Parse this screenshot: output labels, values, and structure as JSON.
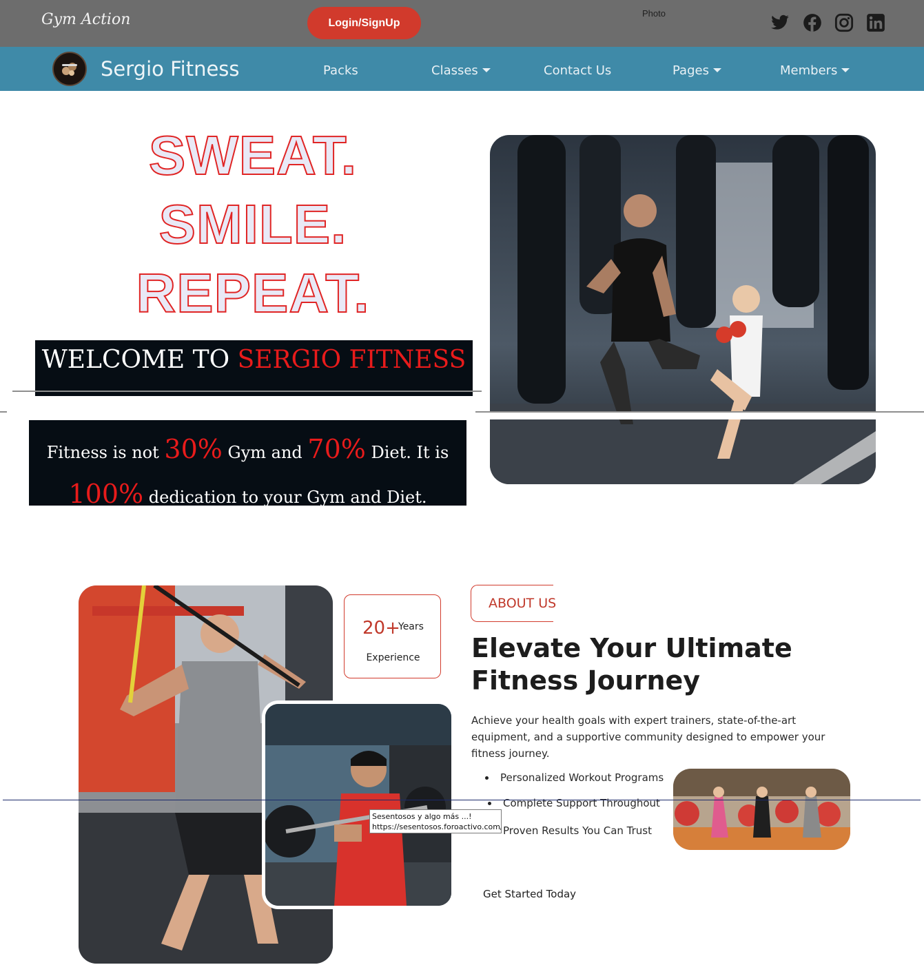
{
  "topbar": {
    "brand": "Gym Action",
    "login_label": "Login/SignUp",
    "photo_label": "Photo",
    "social_icons": [
      "twitter-icon",
      "facebook-icon",
      "instagram-icon",
      "linkedin-icon"
    ]
  },
  "navbar": {
    "title": "Sergio Fitness",
    "items": [
      {
        "label": "Packs",
        "dropdown": false
      },
      {
        "label": "Classes",
        "dropdown": true
      },
      {
        "label": "Contact Us",
        "dropdown": false
      },
      {
        "label": "Pages",
        "dropdown": true
      },
      {
        "label": "Members",
        "dropdown": true
      }
    ]
  },
  "hero": {
    "lines": [
      "SWEAT.",
      "SMILE.",
      "REPEAT."
    ],
    "welcome_prefix": "WELCOME TO",
    "welcome_highlight": "SERGIO FITNESS",
    "quote": {
      "part1": "Fitness is not",
      "pct1": "30%",
      "part2": "Gym and",
      "pct2": "70%",
      "part3": "Diet. It is",
      "pct3": "100%",
      "part4": "dedication to your Gym and Diet."
    }
  },
  "about": {
    "experience_number": "20+",
    "experience_years": "Years",
    "experience_label": "Experience",
    "tag": "ABOUT US",
    "heading": "Elevate Your Ultimate Fitness Journey",
    "description": "Achieve your health goals with expert trainers, state-of-the-art equipment, and a supportive community designed to empower your fitness journey.",
    "features": [
      "Personalized Workout Programs",
      "Complete Support Throughout",
      "Proven Results You Can Trust"
    ],
    "cta": "Get Started Today"
  },
  "tooltip": {
    "line1": "Sesentosos y algo más ...!",
    "line2": "https://sesentosos.foroactivo.com/"
  },
  "colors": {
    "topbar": "#6d6d6d",
    "navbar": "#3f8aa8",
    "accent_red": "#d13a2c",
    "dark_box": "#060d14"
  }
}
